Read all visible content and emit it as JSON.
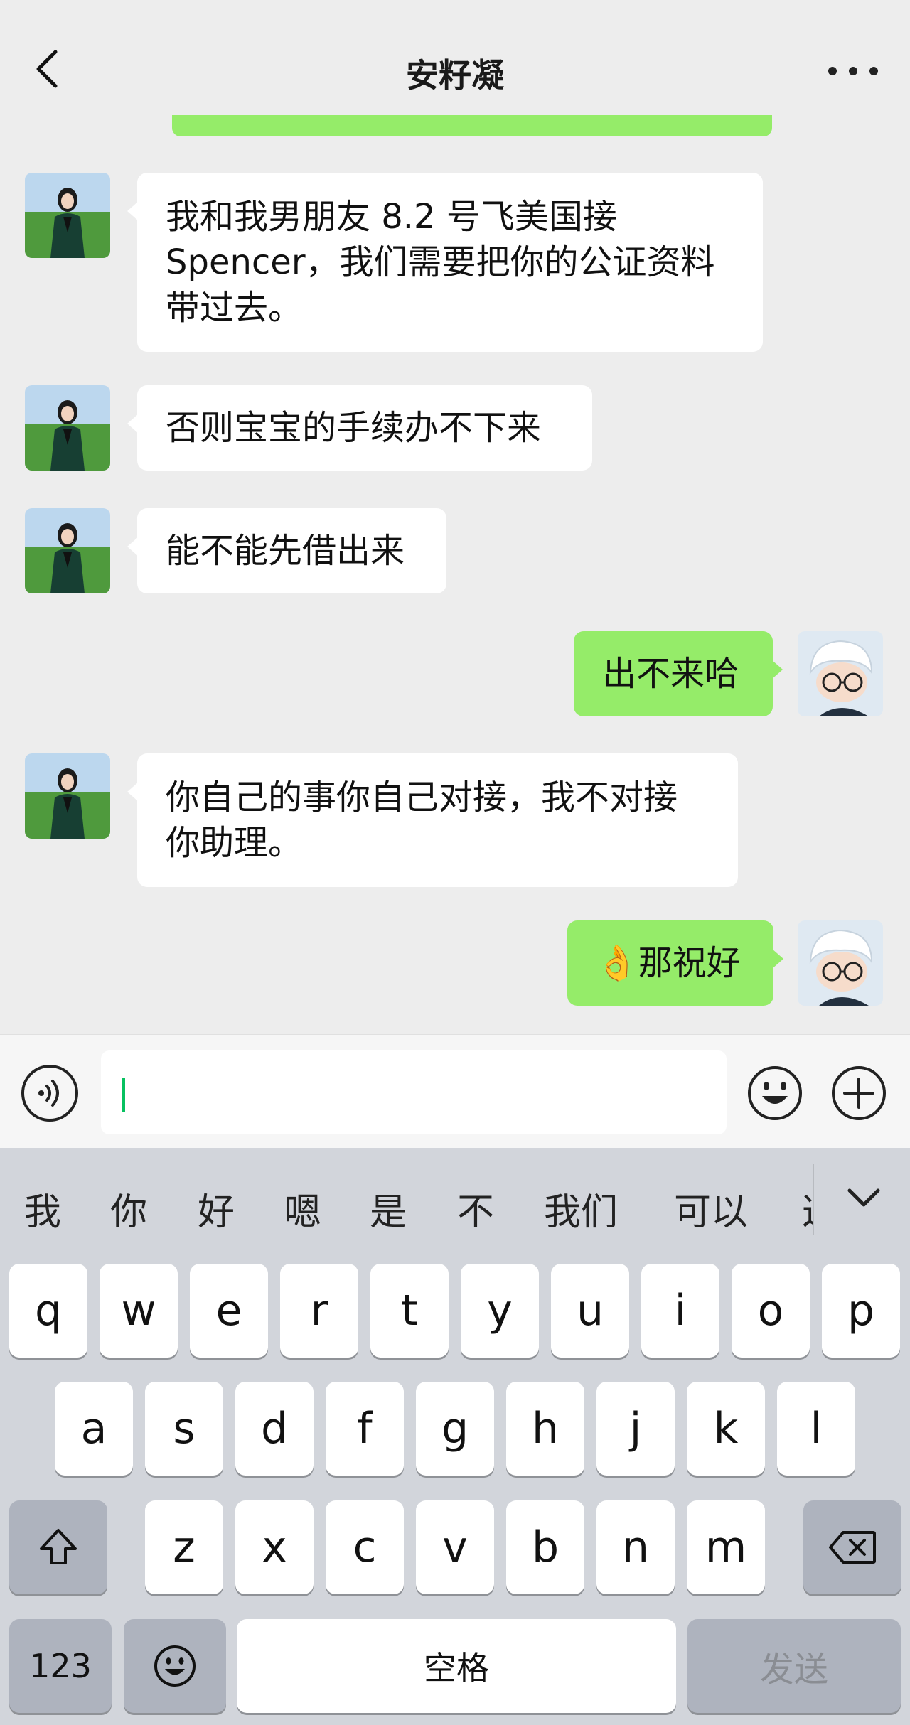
{
  "header": {
    "title": "安籽凝"
  },
  "messages": [
    {
      "side": "left",
      "text": "我和我男朋友 8.2 号飞美国接\nSpencer，我们需要把你的公证资料\n带过去。"
    },
    {
      "side": "left",
      "text": "否则宝宝的手续办不下来"
    },
    {
      "side": "left",
      "text": "能不能先借出来"
    },
    {
      "side": "right",
      "text": "出不来哈"
    },
    {
      "side": "left",
      "text": "你自己的事你自己对接，我不对接\n你助理。"
    },
    {
      "side": "right",
      "text": "👌那祝好"
    }
  ],
  "input": {
    "value": ""
  },
  "keyboard": {
    "candidates": [
      "我",
      "你",
      "好",
      "嗯",
      "是",
      "不",
      "我们",
      "可以",
      "这"
    ],
    "row1": [
      "q",
      "w",
      "e",
      "r",
      "t",
      "y",
      "u",
      "i",
      "o",
      "p"
    ],
    "row2": [
      "a",
      "s",
      "d",
      "f",
      "g",
      "h",
      "j",
      "k",
      "l"
    ],
    "row3": [
      "z",
      "x",
      "c",
      "v",
      "b",
      "n",
      "m"
    ],
    "numbers_label": "123",
    "space_label": "空格",
    "send_label": "发送"
  },
  "colors": {
    "bubble_right": "#95ec69",
    "bubble_left": "#ffffff",
    "background": "#ededed",
    "caret": "#07c160",
    "keyboard_bg": "#d2d5db"
  }
}
